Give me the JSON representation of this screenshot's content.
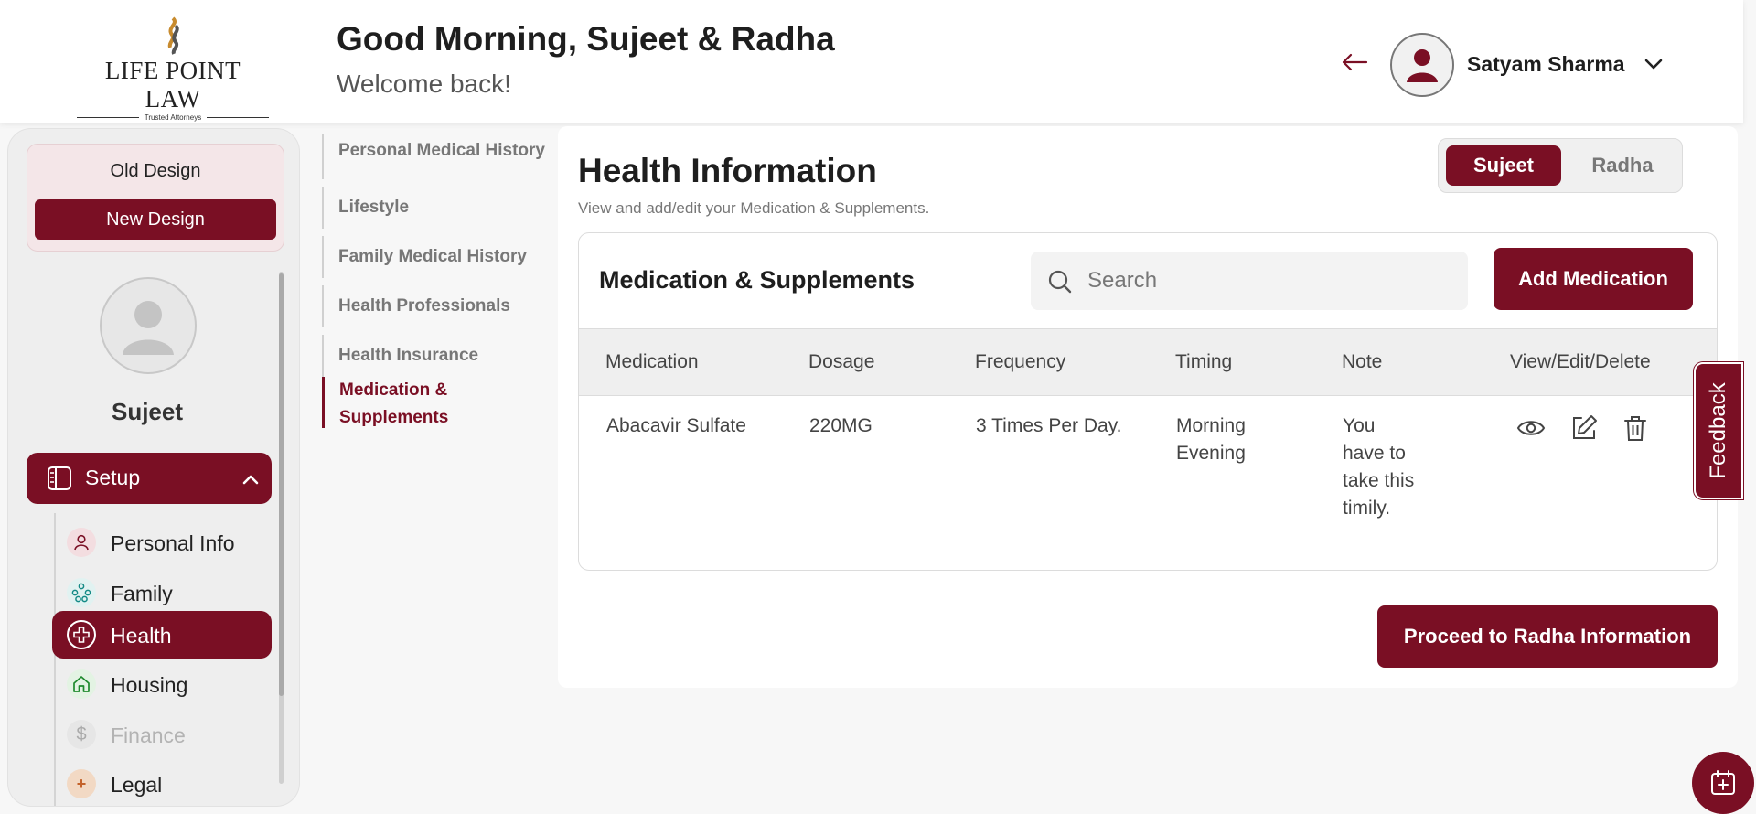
{
  "header": {
    "logo_text": "LIFE POINT LAW",
    "logo_tagline": "Trusted Attorneys",
    "greeting": "Good Morning, Sujeet & Radha",
    "welcome": "Welcome back!",
    "user_name": "Satyam Sharma"
  },
  "sidebar": {
    "old_design_label": "Old Design",
    "new_design_label": "New Design",
    "profile_name": "Sujeet",
    "setup_label": "Setup",
    "items": [
      {
        "label": "Personal Info",
        "icon": "user-icon",
        "state": "normal"
      },
      {
        "label": "Family",
        "icon": "family-icon",
        "state": "normal"
      },
      {
        "label": "Health",
        "icon": "health-cross-icon",
        "state": "active"
      },
      {
        "label": "Housing",
        "icon": "home-icon",
        "state": "normal"
      },
      {
        "label": "Finance",
        "icon": "dollar-icon",
        "state": "disabled"
      },
      {
        "label": "Legal",
        "icon": "legal-icon",
        "state": "normal"
      }
    ]
  },
  "subnav": {
    "items": [
      {
        "label": "Personal Medical History",
        "active": false
      },
      {
        "label": "Lifestyle",
        "active": false
      },
      {
        "label": "Family Medical History",
        "active": false
      },
      {
        "label": "Health Professionals",
        "active": false
      },
      {
        "label": "Health Insurance",
        "active": false
      },
      {
        "label": "Medication & Supplements",
        "active": true
      }
    ]
  },
  "main": {
    "title": "Health Information",
    "subtitle": "View and add/edit your Medication & Supplements.",
    "person_tabs": [
      "Sujeet",
      "Radha"
    ],
    "selected_person": "Sujeet",
    "panel_title": "Medication & Supplements",
    "search_placeholder": "Search",
    "add_button": "Add Medication",
    "table": {
      "headers": [
        "Medication",
        "Dosage",
        "Frequency",
        "Timing",
        "Note",
        "View/Edit/Delete"
      ],
      "rows": [
        {
          "medication": "Abacavir Sulfate",
          "dosage": "220MG",
          "frequency": "3 Times Per Day.",
          "timing_1": "Morning",
          "timing_2": "Evening",
          "note_1": "You",
          "note_2": "have to",
          "note_3": "take this",
          "note_4": "timily."
        }
      ]
    },
    "proceed_button": "Proceed to Radha Information"
  },
  "feedback_label": "Feedback",
  "colors": {
    "brand": "#7a0f24",
    "background": "#f7f7f7",
    "sidebar_bg": "#eeeeee"
  }
}
